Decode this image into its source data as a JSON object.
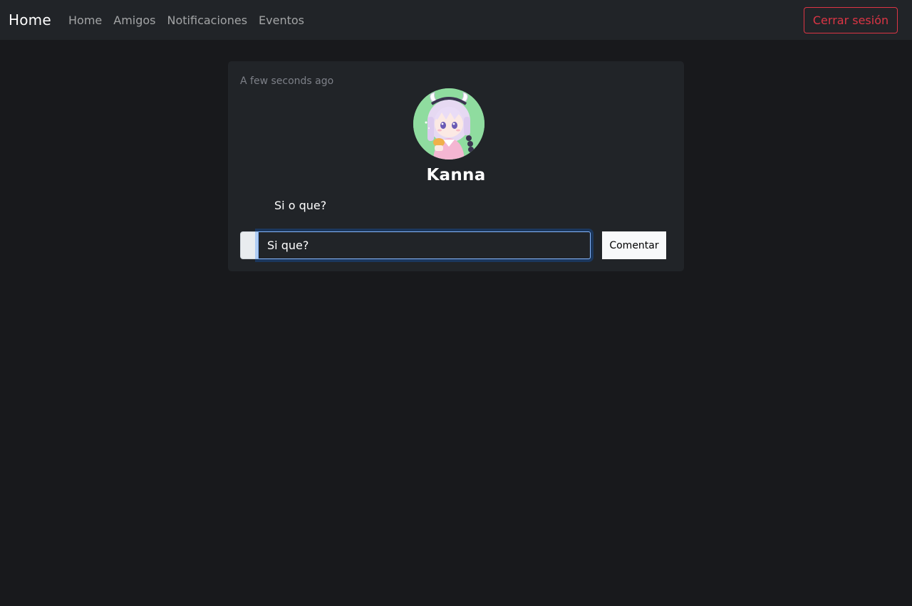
{
  "navbar": {
    "brand": "Home",
    "links": [
      "Home",
      "Amigos",
      "Notificaciones",
      "Eventos"
    ],
    "logout_label": "Cerrar sesión",
    "logout_color": "#dc3545"
  },
  "post": {
    "timestamp": "A few seconds ago",
    "avatar_icon": "user-avatar-anime-girl",
    "username": "Kanna",
    "text": "Si o que?",
    "comment": {
      "value": "Si que?",
      "button_label": "Comentar"
    }
  }
}
